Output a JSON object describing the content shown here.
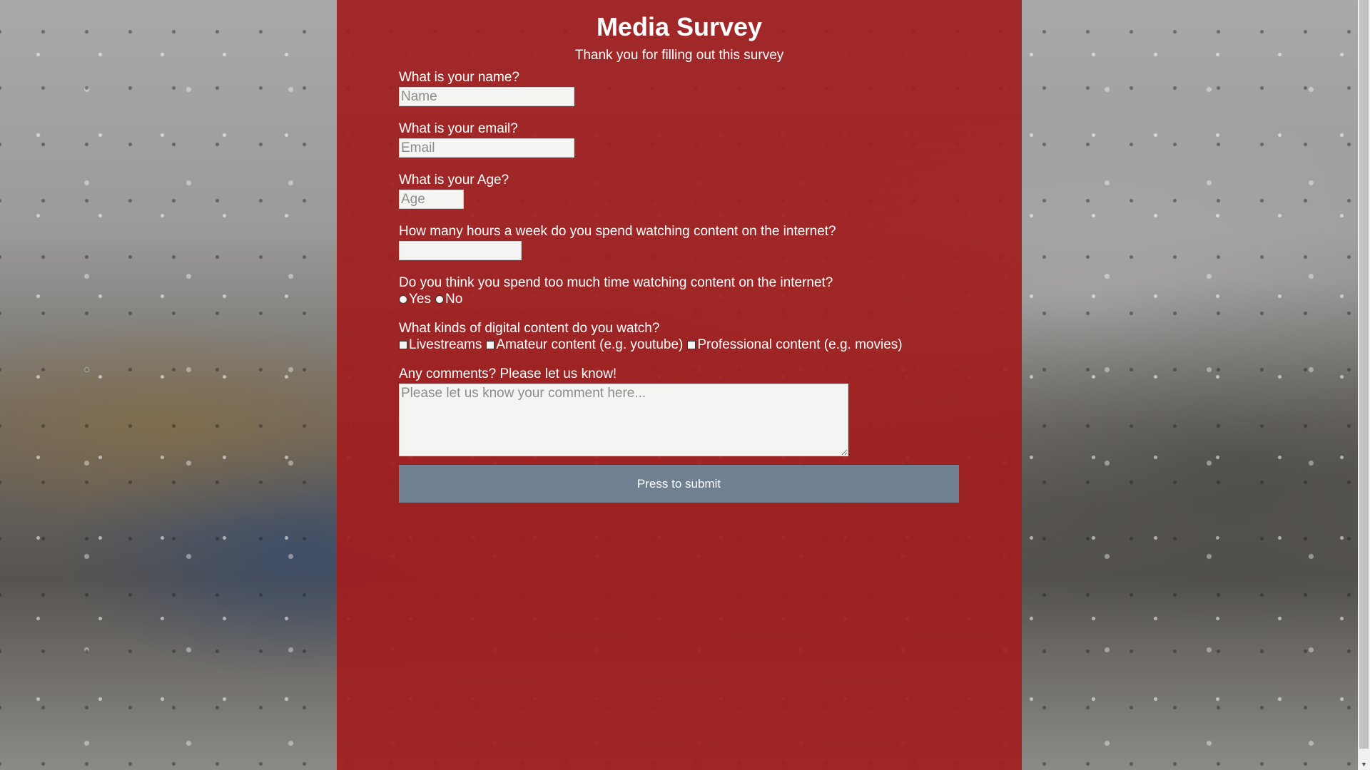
{
  "page": {
    "title": "Media Survey",
    "subtitle": "Thank you for filling out this survey"
  },
  "colors": {
    "panel": "#a01e1e",
    "button": "#708090",
    "text": "#ffffff"
  },
  "form": {
    "name": {
      "label": "What is your name?",
      "placeholder": "Name",
      "value": ""
    },
    "email": {
      "label": "What is your email?",
      "placeholder": "Email",
      "value": ""
    },
    "age": {
      "label": "What is your Age?",
      "placeholder": "Age",
      "value": ""
    },
    "hours": {
      "label": "How many hours a week do you spend watching content on the internet?",
      "value": ""
    },
    "too_much": {
      "label": "Do you think you spend too much time watching content on the internet?",
      "options": [
        "Yes",
        "No"
      ],
      "selected": null
    },
    "content_kinds": {
      "label": "What kinds of digital content do you watch?",
      "options": [
        "Livestreams",
        "Amateur content (e.g. youtube)",
        "Professional content (e.g. movies)"
      ],
      "checked": []
    },
    "comments": {
      "label": "Any comments? Please let us know!",
      "placeholder": "Please let us know your comment here...",
      "value": ""
    },
    "submit_label": "Press to submit"
  },
  "scrollbar": {
    "arrow_icon": "chevron-down-icon"
  }
}
